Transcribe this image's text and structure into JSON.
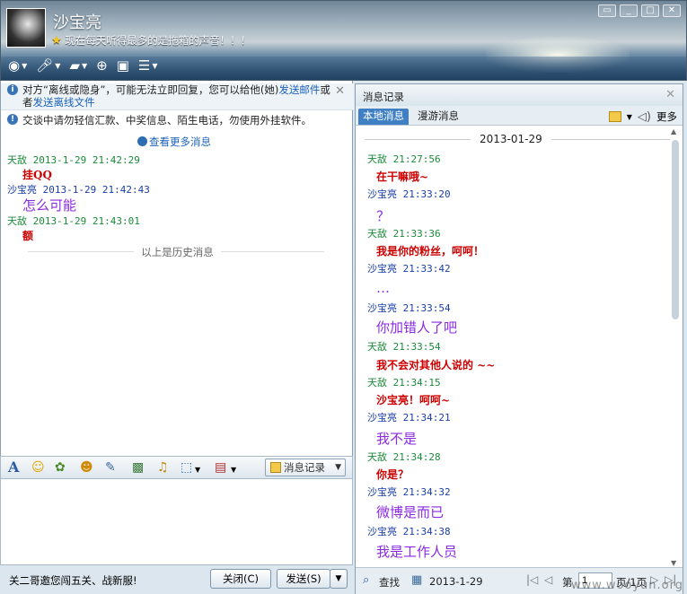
{
  "header": {
    "username": "沙宝亮",
    "signature": "现在每天听得最多的是拖箱的声音！！！",
    "window_controls": [
      "▭",
      "_",
      "□",
      "✕"
    ]
  },
  "toolbar": {
    "icons": [
      "video-call-icon",
      "voice-call-icon",
      "file-transfer-icon",
      "add-user-icon",
      "remote-desktop-icon",
      "more-apps-icon"
    ]
  },
  "left": {
    "notice1_text": "对方“离线或隐身”，可能无法立即回复，您可以给他(她)",
    "notice1_link1": "发送邮件",
    "notice1_mid": "或者",
    "notice1_link2": "发送离线文件",
    "notice2_text": "交谈中请勿轻信汇款、中奖信息、陌生电话，勿使用外挂软件。",
    "more_messages": "查看更多消息",
    "history_divider": "以上是历史消息",
    "messages": [
      {
        "meta": "天敌  2013-1-29 21:42:29",
        "text": "挂QQ"
      },
      {
        "meta": "沙宝亮  2013-1-29 21:42:43",
        "text": "怎么可能"
      },
      {
        "meta": "天敌  2013-1-29 21:43:01",
        "text": "额"
      }
    ]
  },
  "format_bar": {
    "msg_record_label": "消息记录"
  },
  "bottom": {
    "ad_text": "关二哥邀您闯五关、战新服!",
    "close_label": "关闭(C)",
    "send_label": "发送(S)"
  },
  "right": {
    "title": "消息记录",
    "tab_local": "本地消息",
    "tab_roam": "漫游消息",
    "more_label": "更多",
    "date": "2013-01-29",
    "messages": [
      {
        "meta": "天敌  21:27:56",
        "text": "在干嘛哦~"
      },
      {
        "meta": "沙宝亮  21:33:20",
        "text": "？"
      },
      {
        "meta": "天敌  21:33:36",
        "text": "我是你的粉丝，呵呵！"
      },
      {
        "meta": "沙宝亮  21:33:42",
        "text": "…"
      },
      {
        "meta": "沙宝亮  21:33:54",
        "text": "你加错人了吧"
      },
      {
        "meta": "天敌  21:33:54",
        "text": "我不会对其他人说的 ~~"
      },
      {
        "meta": "天敌  21:34:15",
        "text": "沙宝亮！呵呵~"
      },
      {
        "meta": "沙宝亮  21:34:21",
        "text": "我不是"
      },
      {
        "meta": "天敌  21:34:28",
        "text": "你是？"
      },
      {
        "meta": "沙宝亮  21:34:32",
        "text": "微博是而已"
      },
      {
        "meta": "沙宝亮  21:34:38",
        "text": "我是工作人员"
      }
    ],
    "search_label": "查找",
    "date_filter": "2013-1-29",
    "page_prefix": "第",
    "page_value": "1",
    "page_suffix": "页/1页"
  },
  "watermark": "www.wooyun.org",
  "colors": {
    "peer_name": "#1a8a3a",
    "self_name": "#1a3ea8",
    "peer_text": "#cc0000",
    "self_text": "#8a2be2",
    "tab_active": "#3f7fc4"
  }
}
